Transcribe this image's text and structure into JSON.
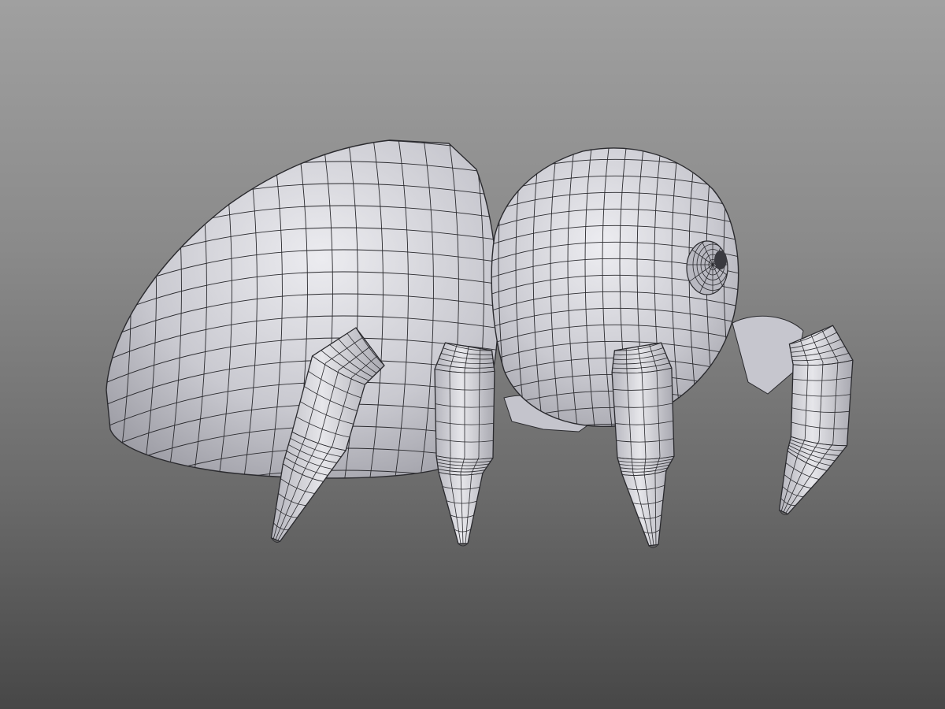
{
  "scene": {
    "subject": "spider-model",
    "render_style": "wireframe-on-shaded",
    "background": {
      "top": "#a0a0a0",
      "bottom": "#474747"
    },
    "mesh_color": "#d8d8de",
    "wire_color": "#2a2a2e"
  }
}
